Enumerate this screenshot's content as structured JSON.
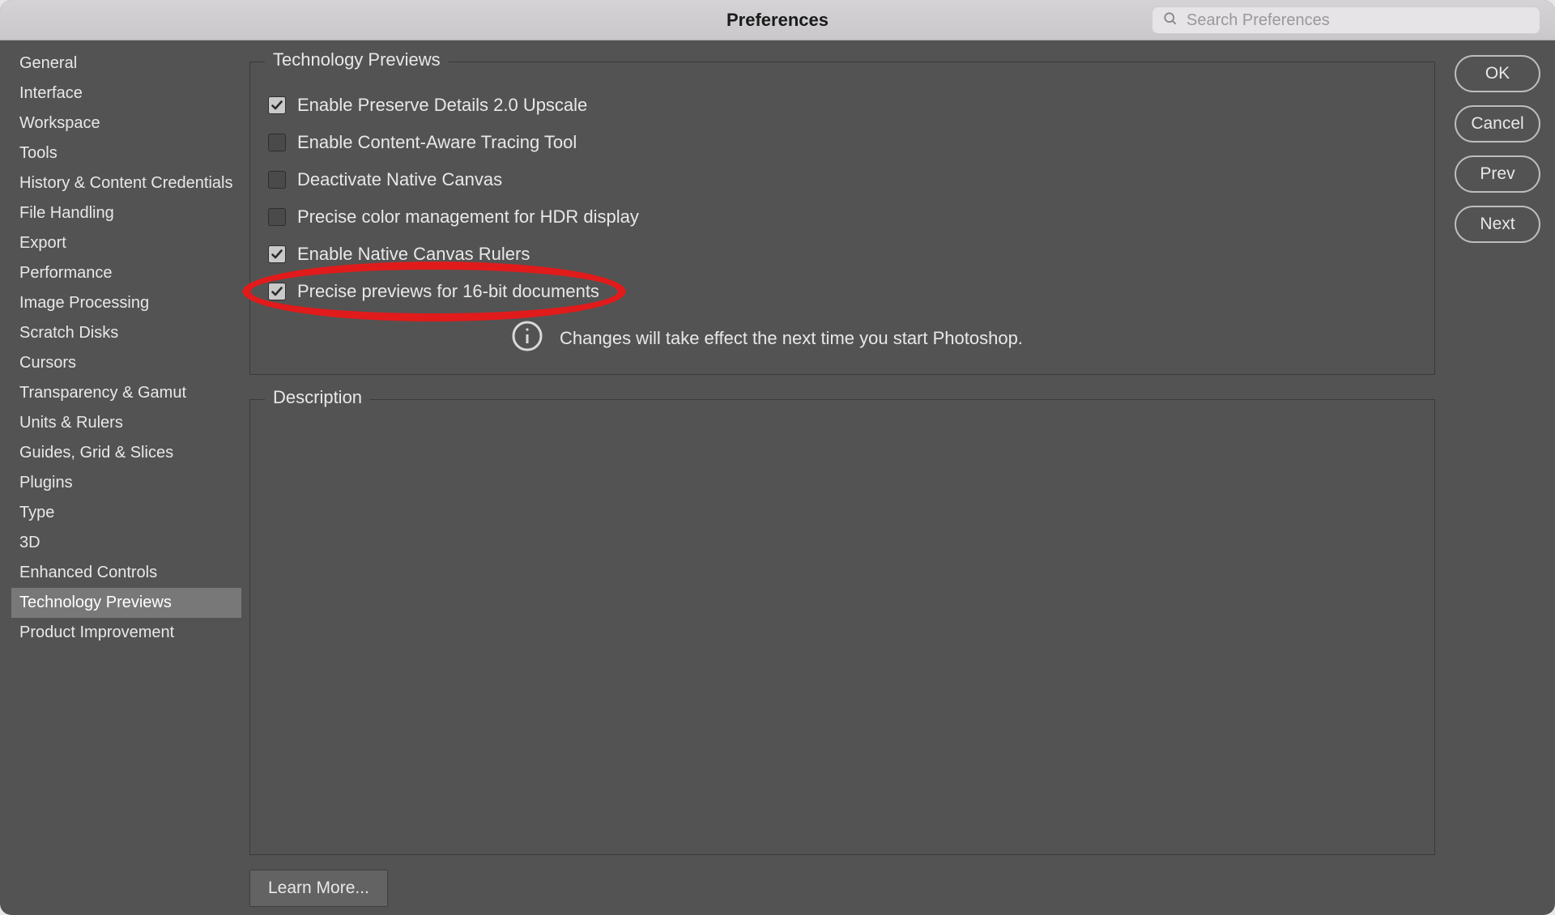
{
  "window": {
    "title": "Preferences",
    "search_placeholder": "Search Preferences"
  },
  "sidebar": {
    "items": [
      {
        "label": "General"
      },
      {
        "label": "Interface"
      },
      {
        "label": "Workspace"
      },
      {
        "label": "Tools"
      },
      {
        "label": "History & Content Credentials"
      },
      {
        "label": "File Handling"
      },
      {
        "label": "Export"
      },
      {
        "label": "Performance"
      },
      {
        "label": "Image Processing"
      },
      {
        "label": "Scratch Disks"
      },
      {
        "label": "Cursors"
      },
      {
        "label": "Transparency & Gamut"
      },
      {
        "label": "Units & Rulers"
      },
      {
        "label": "Guides, Grid & Slices"
      },
      {
        "label": "Plugins"
      },
      {
        "label": "Type"
      },
      {
        "label": "3D"
      },
      {
        "label": "Enhanced Controls"
      },
      {
        "label": "Technology Previews"
      },
      {
        "label": "Product Improvement"
      }
    ],
    "selected_index": 18
  },
  "main": {
    "group_title": "Technology Previews",
    "options": [
      {
        "label": "Enable Preserve Details 2.0 Upscale",
        "checked": true
      },
      {
        "label": "Enable Content-Aware Tracing Tool",
        "checked": false
      },
      {
        "label": "Deactivate Native Canvas",
        "checked": false
      },
      {
        "label": "Precise color management for HDR display",
        "checked": false
      },
      {
        "label": "Enable Native Canvas Rulers",
        "checked": true
      },
      {
        "label": "Precise previews for 16-bit documents",
        "checked": true
      }
    ],
    "info_text": "Changes will take effect the next time you start Photoshop.",
    "description_title": "Description",
    "learn_more_label": "Learn More..."
  },
  "buttons": {
    "ok": "OK",
    "cancel": "Cancel",
    "prev": "Prev",
    "next": "Next"
  },
  "annotation": {
    "highlighted_option_index": 5
  }
}
